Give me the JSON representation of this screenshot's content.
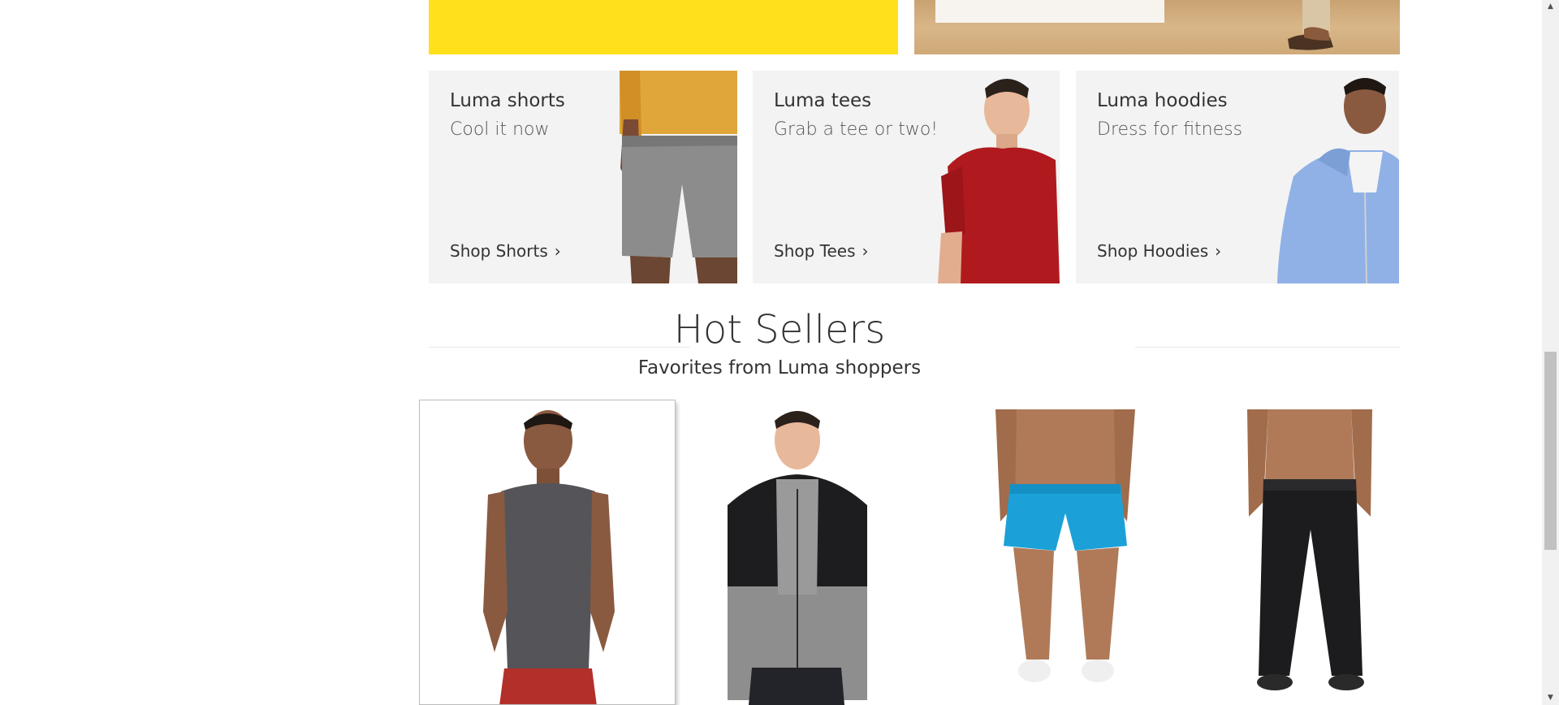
{
  "tiles": [
    {
      "title": "Luma shorts",
      "subtitle": "Cool it now",
      "link": "Shop Shorts"
    },
    {
      "title": "Luma tees",
      "subtitle": "Grab a tee or two!",
      "link": "Shop Tees"
    },
    {
      "title": "Luma hoodies",
      "subtitle": "Dress for fitness",
      "link": "Shop Hoodies"
    }
  ],
  "hot_sellers": {
    "title": "Hot Sellers",
    "subtitle": "Favorites from Luma shoppers"
  },
  "icons": {
    "chevron": "chevron-right-icon",
    "scroll_up": "scroll-up-icon",
    "scroll_down": "scroll-down-icon"
  },
  "colors": {
    "banner_yellow": "#ffe01b",
    "tile_bg": "#f3f3f3",
    "text": "#333333"
  }
}
